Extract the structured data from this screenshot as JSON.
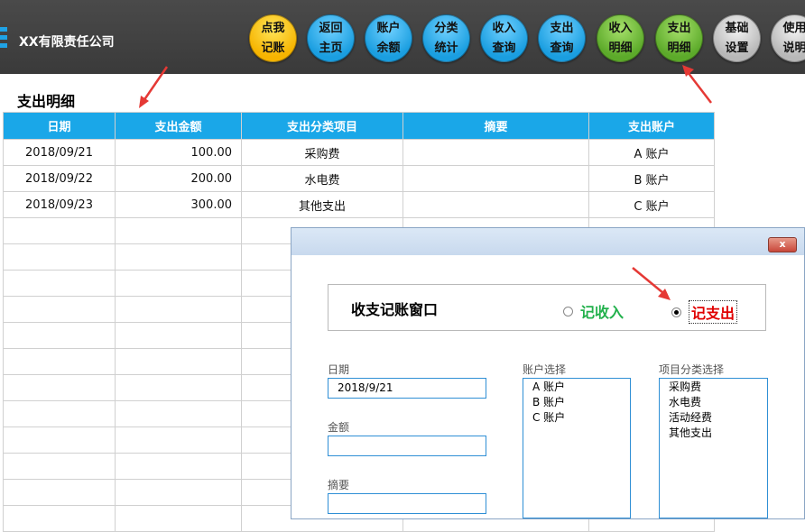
{
  "header": {
    "company": "XX有限责任公司",
    "nav": [
      {
        "line1": "点我",
        "line2": "记账",
        "color": "yellow"
      },
      {
        "line1": "返回",
        "line2": "主页",
        "color": "blue"
      },
      {
        "line1": "账户",
        "line2": "余额",
        "color": "blue"
      },
      {
        "line1": "分类",
        "line2": "统计",
        "color": "blue"
      },
      {
        "line1": "收入",
        "line2": "查询",
        "color": "blue"
      },
      {
        "line1": "支出",
        "line2": "查询",
        "color": "blue"
      },
      {
        "line1": "收入",
        "line2": "明细",
        "color": "green"
      },
      {
        "line1": "支出",
        "line2": "明细",
        "color": "green"
      },
      {
        "line1": "基础",
        "line2": "设置",
        "color": "gray"
      },
      {
        "line1": "使用",
        "line2": "说明",
        "color": "gray"
      }
    ]
  },
  "section_title": "支出明细",
  "table": {
    "headers": [
      "日期",
      "支出金额",
      "支出分类项目",
      "摘要",
      "支出账户"
    ],
    "rows": [
      [
        "2018/09/21",
        "100.00",
        "采购费",
        "",
        "A 账户"
      ],
      [
        "2018/09/22",
        "200.00",
        "水电费",
        "",
        "B 账户"
      ],
      [
        "2018/09/23",
        "300.00",
        "其他支出",
        "",
        "C 账户"
      ]
    ]
  },
  "dialog": {
    "close_label": "x",
    "frame_title": "收支记账窗口",
    "radio_income": "记收入",
    "radio_expense": "记支出",
    "date_label": "日期",
    "date_value": "2018/9/21",
    "amount_label": "金额",
    "amount_value": "",
    "memo_label": "摘要",
    "memo_value": "",
    "account_label": "账户选择",
    "accounts": [
      "A 账户",
      "B 账户",
      "C 账户"
    ],
    "category_label": "项目分类选择",
    "categories": [
      "采购费",
      "水电费",
      "活动经费",
      "其他支出"
    ]
  },
  "colors": {
    "header_bg": "#3f3f3f",
    "table_header": "#1aa7e8",
    "income_green": "#22b14c",
    "expense_red": "#e00000",
    "arrow_red": "#e53935"
  }
}
